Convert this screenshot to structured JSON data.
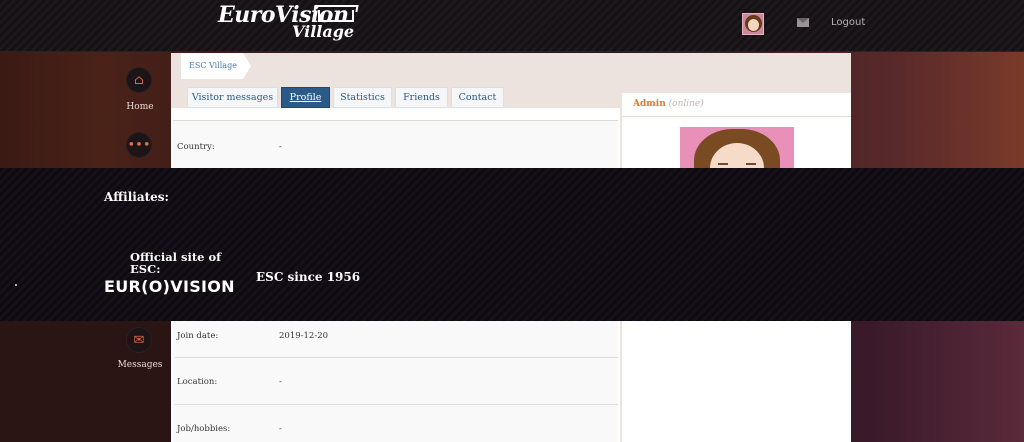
{
  "header": {
    "logo_line1": "EuroVision",
    "logo_line2": "Village",
    "logout_label": "Logout"
  },
  "sidebar": {
    "items": [
      {
        "label": "Home",
        "icon": "home-icon"
      },
      {
        "label": "",
        "icon": "chat-icon"
      },
      {
        "label": "Messages",
        "icon": "messages-icon"
      }
    ]
  },
  "breadcrumb": {
    "label": "ESC Village"
  },
  "tabs": [
    {
      "label": "Visitor messages",
      "active": false
    },
    {
      "label": "Profile",
      "active": true
    },
    {
      "label": "Statistics",
      "active": false
    },
    {
      "label": "Friends",
      "active": false
    },
    {
      "label": "Contact",
      "active": false
    }
  ],
  "profile": {
    "fields": [
      {
        "label": "Country:",
        "value": "-"
      },
      {
        "label": "Join date:",
        "value": "2019-12-20"
      },
      {
        "label": "Location:",
        "value": "-"
      },
      {
        "label": "Job/hobbies:",
        "value": "-"
      }
    ]
  },
  "user": {
    "name": "Admin",
    "status": "(online)"
  },
  "affiliates": {
    "title": "Affiliates:",
    "official_label": "Official site of ESC:",
    "official_logo": "EUR(O)VISION",
    "site2": "ESC since 1956"
  },
  "colors": {
    "accent": "#2a5a88",
    "username": "#e07a2a",
    "sidebar_icon": "#e06a4a"
  }
}
